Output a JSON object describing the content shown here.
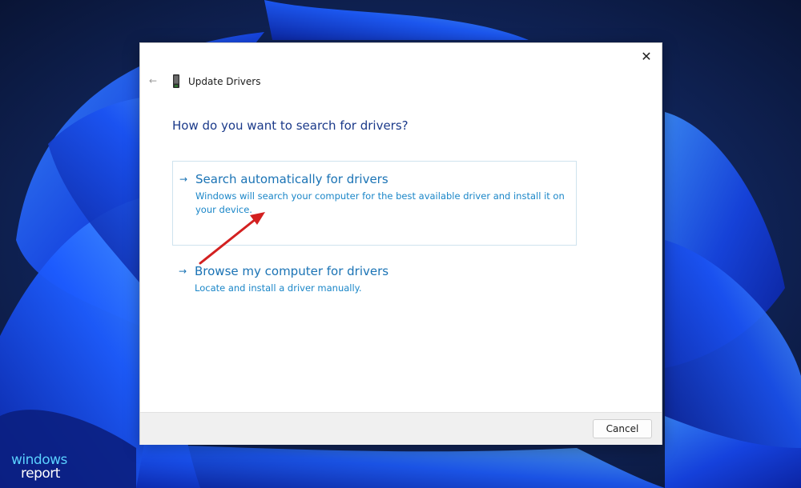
{
  "dialog": {
    "title": "Update Drivers",
    "question": "How do you want to search for drivers?",
    "close_glyph": "✕",
    "back_glyph": "←"
  },
  "options": [
    {
      "title": "Search automatically for drivers",
      "description": "Windows will search your computer for the best available driver and install it on your device."
    },
    {
      "title": "Browse my computer for drivers",
      "description": "Locate and install a driver manually."
    }
  ],
  "footer": {
    "cancel_label": "Cancel"
  },
  "watermark": {
    "line1": "windows",
    "line2": "report"
  },
  "icons": {
    "back": "back-arrow-icon",
    "device": "device-driver-icon",
    "close": "close-icon",
    "option_arrow": "right-arrow-icon"
  },
  "colors": {
    "link_blue": "#1a73b5",
    "question_blue": "#1b3a8a",
    "annotation_red": "#d32020",
    "wallpaper_dark": "#0a1633",
    "wallpaper_blue": "#1a4fff"
  }
}
